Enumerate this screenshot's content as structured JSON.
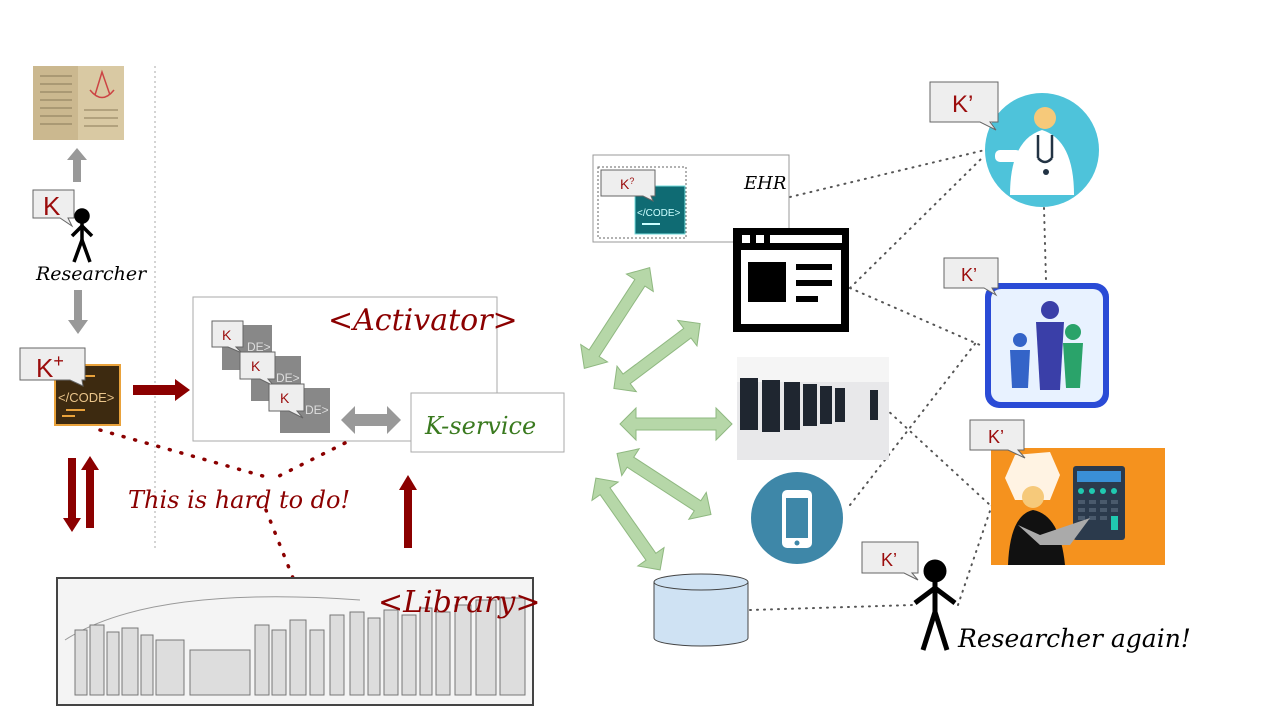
{
  "labels": {
    "researcher": "Researcher",
    "researcher_again": "Researcher again!",
    "activator": "<Activator>",
    "k_service": "K-service",
    "hard_to_do": "This is hard to do!",
    "library": "<Library>",
    "ehr": "EHR",
    "code": "</CODE>"
  },
  "bubbles": {
    "k": "K",
    "k_plus_base": "K",
    "k_plus_sup": "+",
    "k_activator": [
      "K",
      "K",
      "K"
    ],
    "k_question_base": "K",
    "k_question_sup": "?",
    "k_prime": [
      "K’",
      "K’",
      "K’",
      "K’"
    ]
  },
  "colors": {
    "dark_red": "#8b0000",
    "green_text": "#3a7a1f",
    "arrow_green": "#b6d7a8",
    "arrow_gray": "#999999",
    "code_brown": "#3d2a10",
    "code_teal": "#0f6b73",
    "calculator_bg": "#f5921e",
    "doctor_circle": "#4ec3da",
    "phone_circle": "#3e87a8",
    "database_fill": "#cfe2f3"
  },
  "icons": [
    "manuscript-image",
    "stick-figure-icon",
    "code-icon",
    "browser-window-icon",
    "supercomputer-image",
    "smartphone-icon",
    "database-icon",
    "doctor-icon",
    "family-icon",
    "accountant-calculator-icon",
    "library-bookshelf-image"
  ]
}
